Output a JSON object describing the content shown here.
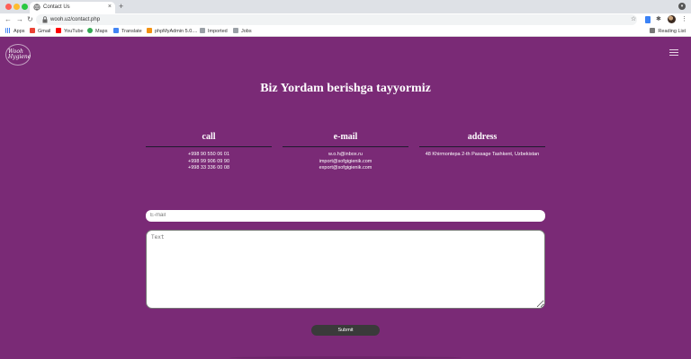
{
  "browser": {
    "tab_title": "Contact Us",
    "url": "wooh.uz/contact.php",
    "bookmarks": [
      "Apps",
      "Gmail",
      "YouTube",
      "Maps",
      "Translate",
      "phpMyAdmin 5.0....",
      "Imported",
      "Jobs"
    ],
    "reading_list": "Reading List"
  },
  "site": {
    "logo_line1": "Wooh",
    "logo_line2": "Hygiene"
  },
  "page": {
    "heading": "Biz Yordam berishga tayyormiz",
    "columns": [
      {
        "title": "call",
        "lines": [
          "+998 90 550 06 01",
          "+998 99 906 09 90",
          "+998 33 336 00 08"
        ]
      },
      {
        "title": "e-mail",
        "lines": [
          "w.o.h@inbox.ru",
          "import@sofgigienik.com",
          "export@sofgigienik.com"
        ]
      },
      {
        "title": "address",
        "lines": [
          "48 Khirmontepa 2-th Passage Tashkent, Uzbekistan"
        ]
      }
    ],
    "email_placeholder": "E-mail",
    "text_placeholder": "Text",
    "submit_label": "Submit"
  },
  "colors": {
    "page_bg": "#7a2a76",
    "submit_bg": "#3a3a3a"
  }
}
